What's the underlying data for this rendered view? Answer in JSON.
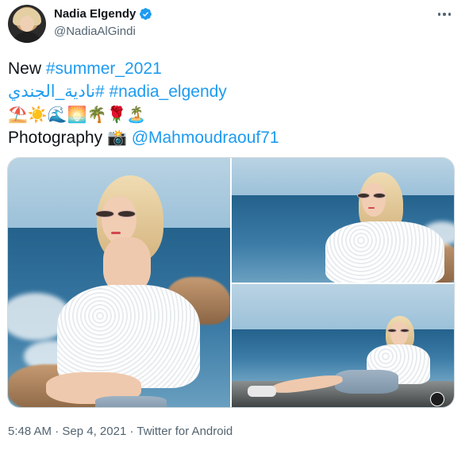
{
  "author": {
    "display_name": "Nadia Elgendy",
    "handle": "@NadiaAlGindi",
    "verified": true
  },
  "tweet": {
    "line1_word": "New",
    "line1_hashtag": "#summer_2021",
    "line2_hashtag_arabic": "#نادية_الجندي",
    "line2_hashtag": "#nadia_elgendy",
    "emojis": "⛱️☀️🌊🌅🌴🌹🏝️",
    "line4_word": "Photography",
    "camera_emoji": "📸",
    "mention": "@Mahmoudraouf71"
  },
  "media": {
    "photos": [
      {
        "description": "photo-1"
      },
      {
        "description": "photo-2"
      },
      {
        "description": "photo-3"
      }
    ]
  },
  "meta": {
    "time": "5:48 AM",
    "date": "Sep 4, 2021",
    "source": "Twitter for Android",
    "separator": "·"
  },
  "colors": {
    "link": "#1d9bf0",
    "text": "#0f1419",
    "secondary": "#536471",
    "verified": "#1d9bf0"
  },
  "icons": [
    "verified-badge-icon",
    "more-options-icon",
    "alt-badge-icon"
  ]
}
